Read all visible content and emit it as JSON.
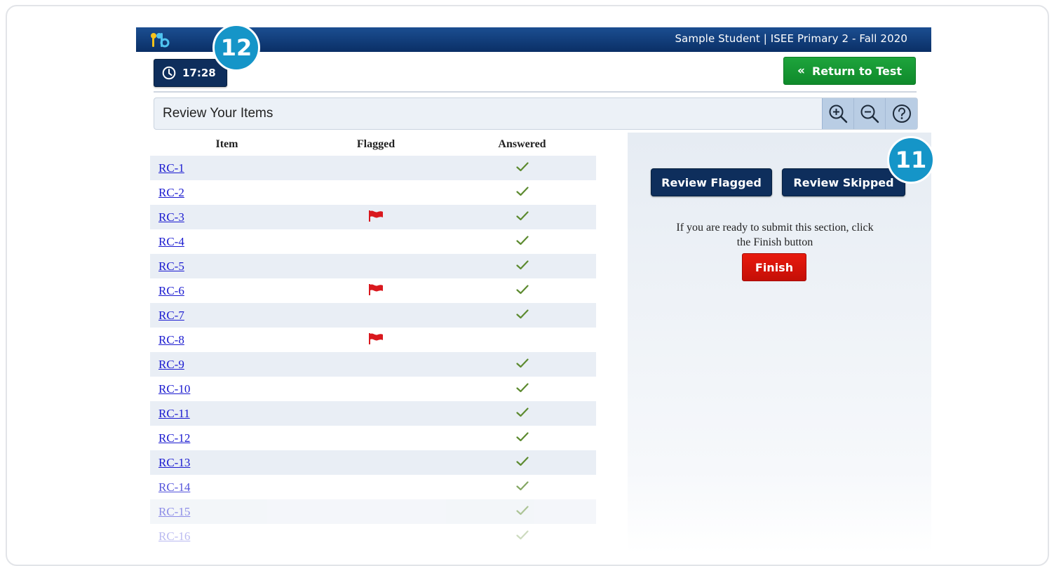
{
  "header": {
    "user_info": "Sample Student | ISEE Primary 2 - Fall 2020"
  },
  "toolbar": {
    "timer": "17:28",
    "return_label": "Return to Test",
    "return_icon": "«"
  },
  "review": {
    "title": "Review Your Items",
    "tools": [
      "zoom-in-icon",
      "zoom-out-icon",
      "help-icon"
    ]
  },
  "table": {
    "headers": {
      "item": "Item",
      "flagged": "Flagged",
      "answered": "Answered"
    },
    "rows": [
      {
        "item": "RC-1",
        "flagged": false,
        "answered": true
      },
      {
        "item": "RC-2",
        "flagged": false,
        "answered": true
      },
      {
        "item": "RC-3",
        "flagged": true,
        "answered": true
      },
      {
        "item": "RC-4",
        "flagged": false,
        "answered": true
      },
      {
        "item": "RC-5",
        "flagged": false,
        "answered": true
      },
      {
        "item": "RC-6",
        "flagged": true,
        "answered": true
      },
      {
        "item": "RC-7",
        "flagged": false,
        "answered": true
      },
      {
        "item": "RC-8",
        "flagged": true,
        "answered": false
      },
      {
        "item": "RC-9",
        "flagged": false,
        "answered": true
      },
      {
        "item": "RC-10",
        "flagged": false,
        "answered": true
      },
      {
        "item": "RC-11",
        "flagged": false,
        "answered": true
      },
      {
        "item": "RC-12",
        "flagged": false,
        "answered": true
      },
      {
        "item": "RC-13",
        "flagged": false,
        "answered": true
      },
      {
        "item": "RC-14",
        "flagged": false,
        "answered": true
      },
      {
        "item": "RC-15",
        "flagged": false,
        "answered": true
      },
      {
        "item": "RC-16",
        "flagged": false,
        "answered": true
      }
    ]
  },
  "panel": {
    "review_flagged": "Review Flagged",
    "review_skipped": "Review Skipped",
    "submit_text": "If you are ready to submit this section, click the Finish button",
    "finish": "Finish"
  },
  "badges": {
    "timer_badge": "12",
    "skipped_badge": "11"
  },
  "colors": {
    "header_blue": "#0a2f66",
    "navy_button": "#0e2e5c",
    "return_green": "#0f8a2b",
    "finish_red": "#c40f06",
    "badge_blue": "#1595c8",
    "flag_red": "#d9181e",
    "check_green": "#5c8a2f"
  }
}
